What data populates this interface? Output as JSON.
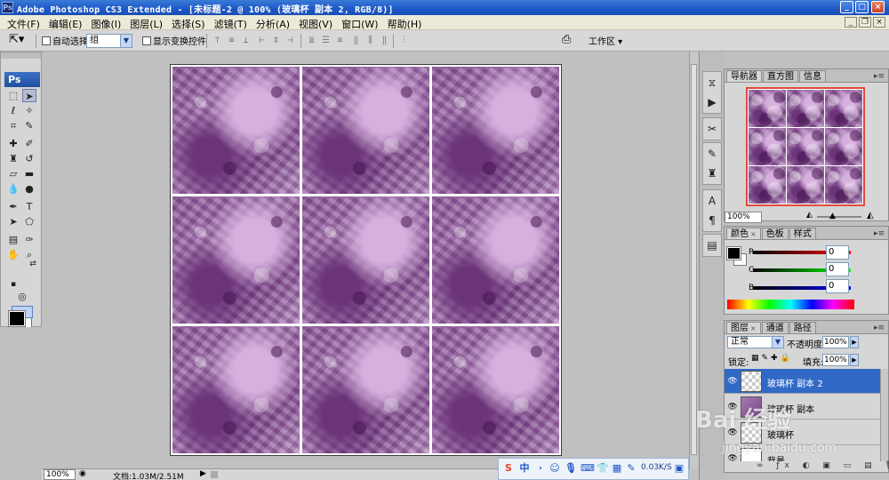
{
  "window": {
    "title": "Adobe Photoshop CS3 Extended - [未标题-2 @ 100% (玻璃杯 副本 2, RGB/8)]",
    "app_icon": "Ps",
    "minimize": "_",
    "maximize": "□",
    "close": "×"
  },
  "menubar": {
    "items": [
      "文件(F)",
      "编辑(E)",
      "图像(I)",
      "图层(L)",
      "选择(S)",
      "滤镜(T)",
      "分析(A)",
      "视图(V)",
      "窗口(W)",
      "帮助(H)"
    ]
  },
  "options": {
    "auto_select_label": "自动选择:",
    "auto_select_value": "组",
    "show_transform_label": "显示变换控件",
    "workspace_label": "工作区 ▾"
  },
  "toolbox": {
    "logo": "Ps"
  },
  "panels": {
    "navigator": {
      "tabs": [
        "导航器",
        "直方图",
        "信息"
      ],
      "zoom": "100%"
    },
    "color": {
      "tabs": [
        "颜色",
        "色板",
        "样式"
      ],
      "r_label": "R",
      "g_label": "G",
      "b_label": "B",
      "r_value": "0",
      "g_value": "0",
      "b_value": "0"
    },
    "layers": {
      "tabs": [
        "图层",
        "通道",
        "路径"
      ],
      "blend_mode": "正常",
      "opacity_label": "不透明度:",
      "opacity_value": "100%",
      "lock_label": "锁定:",
      "fill_label": "填充:",
      "fill_value": "100%",
      "rows": [
        {
          "name": "玻璃杯 副本 2",
          "active": true
        },
        {
          "name": "玻璃杯 副本",
          "active": false
        },
        {
          "name": "玻璃杯",
          "active": false
        },
        {
          "name": "背景",
          "active": false
        }
      ]
    }
  },
  "statusbar": {
    "zoom": "100%",
    "doc": "文档:1.03M/2.51M"
  },
  "tray": {
    "speed": "0.03K/S"
  },
  "watermark": {
    "line1": "Bai 经验",
    "line2": "jingyan.baidu.com"
  }
}
